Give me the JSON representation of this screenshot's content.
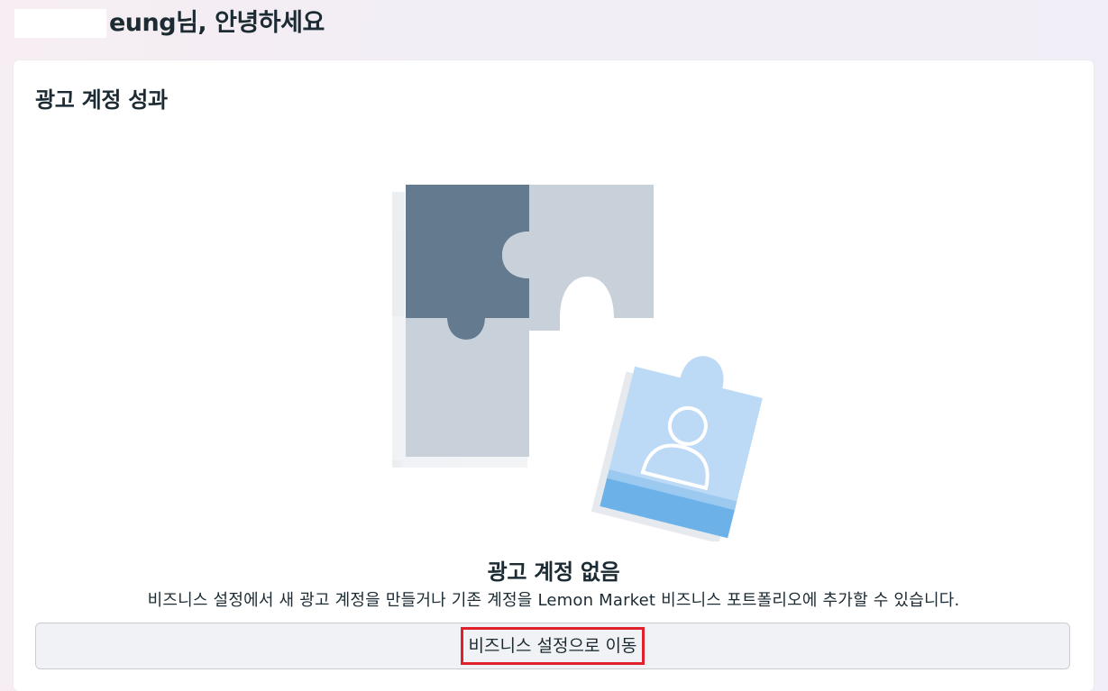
{
  "header": {
    "greeting": "eung님, 안녕하세요"
  },
  "card": {
    "title": "광고 계정 성과",
    "empty_state": {
      "illustration_icon": "puzzle-pieces-user-icon",
      "title": "광고 계정 없음",
      "description": "비즈니스 설정에서 새 광고 계정을 만들거나 기존 계정을 Lemon Market 비즈니스 포트폴리오에 추가할 수 있습니다.",
      "button_label": "비즈니스 설정으로 이동"
    }
  },
  "colors": {
    "puzzle_dark": "#647a8e",
    "puzzle_light": "#c8d0da",
    "puzzle_blue": "#bcd9f5",
    "puzzle_blue_accent": "#6cb1e8",
    "highlight_border": "#e0202a",
    "button_bg": "#f0f2f5"
  }
}
